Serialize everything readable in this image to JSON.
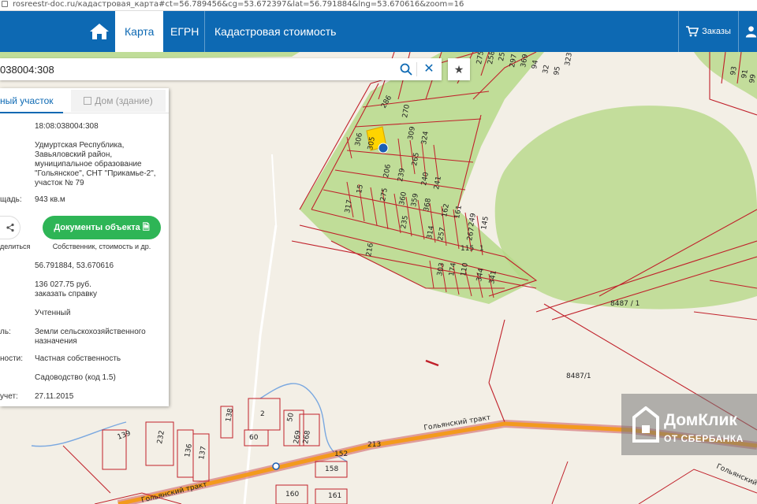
{
  "url": "rosreestr-doc.ru/кадастровая_карта#ct=56.789456&cg=53.672397&lat=56.791884&lng=53.670616&zoom=16",
  "nav": {
    "tabs": [
      "Карта",
      "ЕГРН",
      "Кадастровая стоимость"
    ],
    "orders_label": "Заказы"
  },
  "search": {
    "value": "038004:308"
  },
  "panel": {
    "tab_land": "ный участок",
    "tab_house": "Дом (здание)",
    "cadastral_number": "18:08:038004:308",
    "address": "Удмуртская Республика, Завьяловский район, муниципальное образование \"Гольянское\", СНТ \"Прикамье-2\", участок № 79",
    "area_label": "щадь:",
    "area_value": "943 кв.м",
    "share_label": "делиться",
    "docs_button": "Документы объекта",
    "docs_sub": "Собственник, стоимость и др.",
    "coords": "56.791884, 53.670616",
    "cost": "136 027.75 руб.",
    "order_link": "заказать справку",
    "status": "Учтенный",
    "category_label": "ль:",
    "category": "Земли сельскохозяйственного назначения",
    "ownership_label": "ности:",
    "ownership": "Частная собственность",
    "usage": "Садоводство (код 1.5)",
    "registered_label": "учет:",
    "registered_date": "27.11.2015"
  },
  "map_labels": {
    "parcel_numbers": [
      "306",
      "305",
      "309",
      "324",
      "286",
      "270",
      "265",
      "206",
      "239",
      "240",
      "241",
      "317",
      "15",
      "275",
      "360",
      "359",
      "368",
      "162",
      "161",
      "249",
      "145",
      "235",
      "314",
      "257",
      "267",
      "115",
      "1",
      "216",
      "303",
      "174",
      "110",
      "344",
      "341",
      "288",
      "266",
      "289",
      "275",
      "258",
      "257",
      "297",
      "369",
      "94",
      "32",
      "95",
      "323",
      "93",
      "91",
      "99"
    ],
    "bottom_numbers": [
      "138",
      "2",
      "50",
      "60",
      "269",
      "268",
      "139",
      "232",
      "136",
      "137",
      "213",
      "152",
      "158",
      "160",
      "161"
    ],
    "parcel_8487": "8487/1",
    "parcel_8487_b": "8487 / 1",
    "road_1": "Гольянский тракт",
    "road_2": "Гольянский тракт",
    "road_3": "Гольянский тр"
  },
  "watermark": {
    "line1": "ДомКлик",
    "line2": "ОТ СБЕРБАНКА"
  },
  "colors": {
    "nav": "#0d69b3",
    "green_button": "#2eb556",
    "parcel_border": "#c0202a",
    "forest": "#c3dd9b",
    "road": "#f39a1d"
  }
}
